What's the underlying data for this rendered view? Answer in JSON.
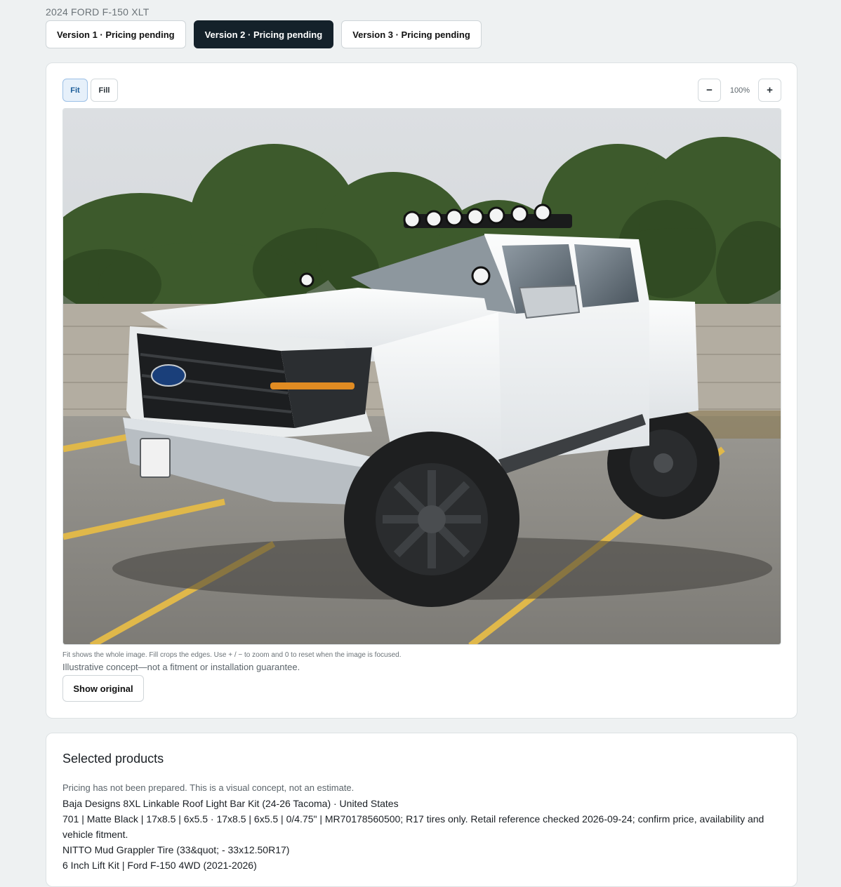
{
  "vehicle": {
    "title": "2024 FORD F-150 XLT"
  },
  "versions": [
    {
      "label": "Version 1 · Pricing pending",
      "active": false
    },
    {
      "label": "Version 2 · Pricing pending",
      "active": true
    },
    {
      "label": "Version 3 · Pricing pending",
      "active": false
    }
  ],
  "viewer": {
    "fit_label": "Fit",
    "fill_label": "Fill",
    "zoom_out_icon": "minus-icon",
    "zoom_in_icon": "plus-icon",
    "zoom_out_glyph": "−",
    "zoom_in_glyph": "+",
    "zoom_level": "100%",
    "help_text": "Fit shows the whole image. Fill crops the edges. Use + / − to zoom and 0 to reset when the image is focused.",
    "disclaimer": "Illustrative concept—not a fitment or installation guarantee.",
    "show_original_label": "Show original"
  },
  "products": {
    "title": "Selected products",
    "pricing_note": "Pricing has not been prepared. This is a visual concept, not an estimate.",
    "lines": [
      "Baja Designs 8XL Linkable Roof Light Bar Kit (24-26 Tacoma) · United States",
      "701 | Matte Black | 17x8.5 | 6x5.5 · 17x8.5 | 6x5.5 | 0/4.75\" | MR70178560500; R17 tires only. Retail reference checked 2026-09-24; confirm price, availability and vehicle fitment.",
      "NITTO Mud Grappler Tire (33&quot; - 33x12.50R17)",
      "6 Inch Lift Kit | Ford F-150 4WD (2021-2026)"
    ]
  },
  "colors": {
    "active_tab": "#14212a",
    "fit_active_bg": "#e6f0fa",
    "page_bg": "#eef1f2",
    "truck_body": "#f2f4f5",
    "parking_stripe": "#e0b84a"
  }
}
